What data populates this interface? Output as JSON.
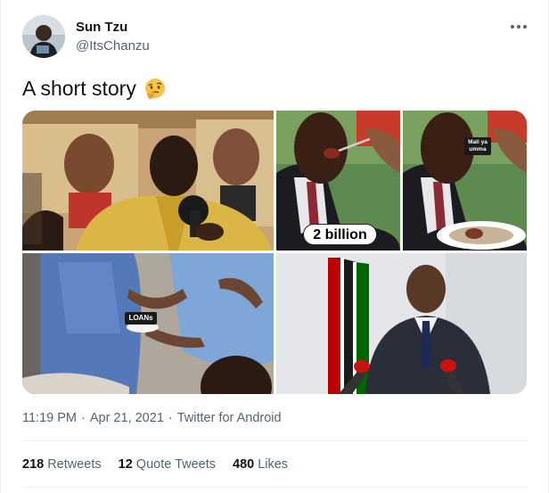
{
  "author": {
    "display_name": "Sun Tzu",
    "handle": "@ItsChanzu"
  },
  "tweet": {
    "text": "A short story",
    "emoji": "thinking-face"
  },
  "media": {
    "panels": [
      {
        "caption": ""
      },
      {
        "caption": "2 billion"
      },
      {
        "caption": "Mali ya umma"
      },
      {
        "caption": "LOANs"
      },
      {
        "caption": ""
      }
    ]
  },
  "meta": {
    "time": "11:19 PM",
    "separator": "·",
    "date": "Apr 21, 2021",
    "source": "Twitter for Android"
  },
  "stats": {
    "retweets_count": "218",
    "retweets_label": "Retweets",
    "quotes_count": "12",
    "quotes_label": "Quote Tweets",
    "likes_count": "480",
    "likes_label": "Likes"
  },
  "colors": {
    "text_primary": "#0f1419",
    "text_secondary": "#536471",
    "divider": "#eff3f4",
    "kenya_red": "#bb0000",
    "kenya_green": "#006600"
  }
}
